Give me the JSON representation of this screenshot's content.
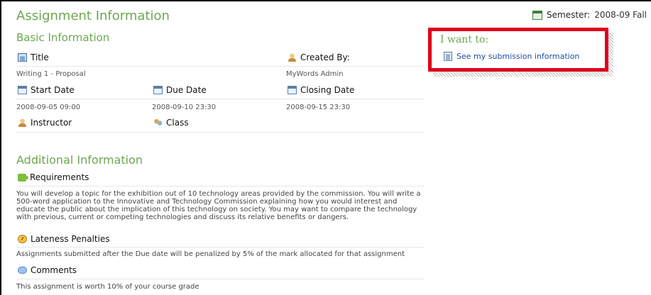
{
  "header": {
    "title": "Assignment Information",
    "semester_label": "Semester:",
    "semester_value": "2008-09 Fall"
  },
  "basic": {
    "heading": "Basic Information",
    "title_label": "Title",
    "title_value": "Writing 1 - Proposal",
    "created_by_label": "Created By:",
    "created_by_value": "MyWords Admin",
    "start_label": "Start Date",
    "start_value": "2008-09-05 09:00",
    "due_label": "Due Date",
    "due_value": "2008-09-10 23:30",
    "closing_label": "Closing Date",
    "closing_value": "2008-09-15 23:30",
    "instructor_label": "Instructor",
    "class_label": "Class"
  },
  "additional": {
    "heading": "Additional Information",
    "requirements_label": "Requirements",
    "requirements_text": "You will develop a topic for the exhibition out of 10 technology areas provided by the commission. You will write a 500-word application to the Innovative and Technology Commission explaining how you would interest and educate the public about the implication of this technology on society. You may want to compare the technology with previous, current or competing technologies and discuss its relative benefits or dangers.",
    "lateness_label": "Lateness Penalties",
    "lateness_text": "Assignments submitted after the Due date will be penalized by 5% of the mark allocated for that assignment",
    "comments_label": "Comments",
    "comments_text": "This assignment is worth 10% of your course grade"
  },
  "want": {
    "heading": "I want to:",
    "link_label": "See my submission information"
  },
  "colors": {
    "accent_green": "#6aa84f",
    "highlight_red": "#e0001a",
    "link_blue": "#1f4fa0"
  }
}
